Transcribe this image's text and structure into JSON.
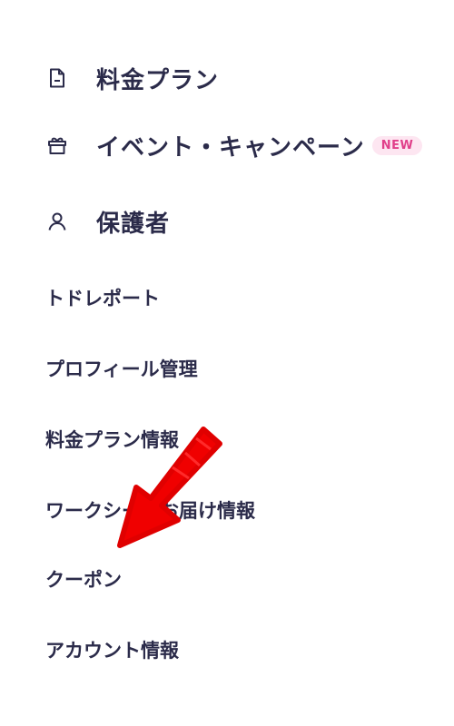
{
  "menu": {
    "main_items": [
      {
        "label": "料金プラン",
        "icon": "document-icon"
      },
      {
        "label": "イベント・キャンペーン",
        "icon": "gift-icon",
        "badge": "NEW"
      },
      {
        "label": "保護者",
        "icon": "person-icon"
      }
    ],
    "sub_items": [
      {
        "label": "トドレポート"
      },
      {
        "label": "プロフィール管理"
      },
      {
        "label": "料金プラン情報"
      },
      {
        "label": "ワークシートお届け情報"
      },
      {
        "label": "クーポン"
      },
      {
        "label": "アカウント情報"
      }
    ]
  },
  "colors": {
    "text": "#2b2b4a",
    "badge_bg": "#fde6f1",
    "badge_text": "#e0408a",
    "annotation_arrow": "#f00000"
  }
}
